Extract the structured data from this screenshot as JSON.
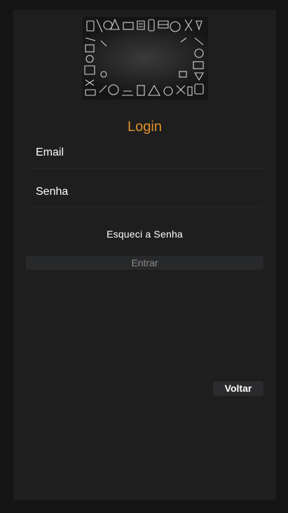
{
  "login": {
    "title": "Login",
    "email_placeholder": "Email",
    "password_placeholder": "Senha",
    "forgot_label": "Esqueci a Senha",
    "enter_label": "Entrar",
    "back_label": "Voltar"
  },
  "banner": {
    "image": "chalkboard-school-doodles"
  },
  "colors": {
    "background": "#141414",
    "card": "#1e1e1f",
    "accent": "#e0912a",
    "text": "#ffffff",
    "button_disabled_text": "#8a8a8a"
  }
}
